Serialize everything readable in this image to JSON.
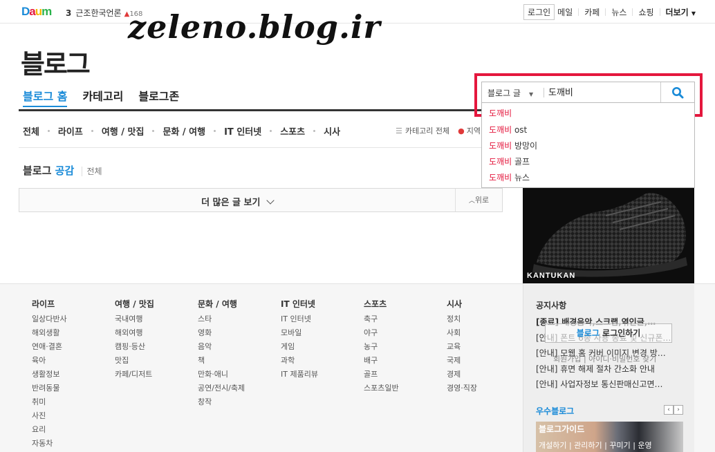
{
  "topbar": {
    "logo": "Daum",
    "logo_colors": [
      "#1a8bd8",
      "#e4173d",
      "#f7b600",
      "#2ab24b"
    ],
    "rank_num": "3",
    "rank_text": "근조한국언론",
    "rank_change": "168",
    "nav": [
      "로그인",
      "메일",
      "카페",
      "뉴스",
      "쇼핑",
      "더보기"
    ]
  },
  "watermark": "zeleno.blog.ir",
  "page_title": "블로그",
  "tabs": [
    "블로그 홈",
    "카테고리",
    "블로그존"
  ],
  "categories": [
    "전체",
    "라이프",
    "여행 / 맛집",
    "문화 / 여행",
    "IT 인터넷",
    "스포츠",
    "시사"
  ],
  "cat_right": {
    "all_label": "카테고리 전체",
    "region_label": "지역"
  },
  "gonggam": {
    "prefix": "블로그",
    "accent": "공감",
    "all": "전체"
  },
  "more_button": "더 많은 글 보기",
  "up_button": "위로",
  "search": {
    "select_value": "블로그 글",
    "input_value": "도깨비",
    "suggestions": [
      {
        "hl": "도깨비",
        "rest": ""
      },
      {
        "hl": "도깨비",
        "rest": " ost"
      },
      {
        "hl": "도깨비",
        "rest": " 방망이"
      },
      {
        "hl": "도깨비",
        "rest": " 골프"
      },
      {
        "hl": "도깨비",
        "rest": " 뉴스"
      }
    ]
  },
  "ad": {
    "label": "KANTUKAN"
  },
  "footer_cols": [
    {
      "head": "라이프",
      "items": [
        "일상다반사",
        "해외생활",
        "연애·결혼",
        "육아",
        "생활정보",
        "반려동물",
        "취미",
        "사진",
        "요리",
        "자동차"
      ]
    },
    {
      "head": "여행 / 맛집",
      "items": [
        "국내여행",
        "해외여행",
        "캠핑·등산",
        "맛집",
        "카페/디저트"
      ]
    },
    {
      "head": "문화 / 여행",
      "items": [
        "스타",
        "영화",
        "음악",
        "책",
        "만화·애니",
        "공연/전시/축제",
        "창작"
      ]
    },
    {
      "head": "IT 인터넷",
      "items": [
        "IT 인터넷",
        "모바일",
        "게임",
        "과학",
        "IT 제품리뷰"
      ]
    },
    {
      "head": "스포츠",
      "items": [
        "축구",
        "야구",
        "농구",
        "배구",
        "골프",
        "스포츠일반"
      ]
    },
    {
      "head": "시사",
      "items": [
        "정치",
        "사회",
        "교육",
        "국제",
        "경제",
        "경영·직장"
      ]
    }
  ],
  "notice": {
    "title": "공지사항",
    "items": [
      "[종료] 배경음악,스크랩,엮인글,…",
      "[안내] 폰트 6종 사용 종료 및 신규폰…",
      "[안내] 모웹 홈 커버 이미지 변경 방…",
      "[안내] 휴면 해제 절차 간소화 안내",
      "[안내] 사업자정보 통신판매신고면…"
    ]
  },
  "login_overlay": {
    "accent": "블로그",
    "rest": " 로그인하기"
  },
  "login_links": "회원가입 | 아이디·비밀번호 찾기",
  "best": {
    "title": "우수블로그",
    "caption": "블로그가이드",
    "sub": "개설하기 | 관리하기 | 꾸미기 | 운영"
  }
}
